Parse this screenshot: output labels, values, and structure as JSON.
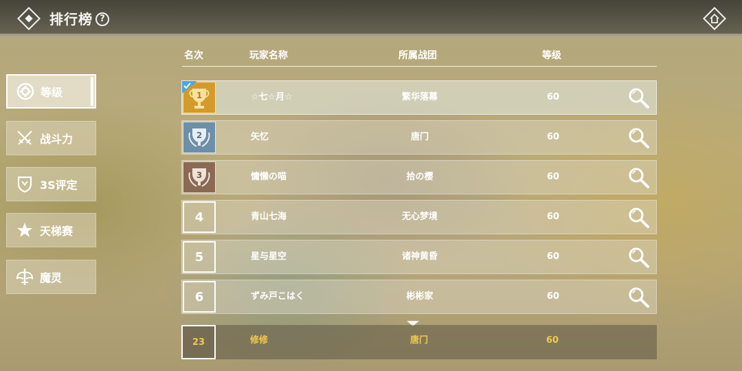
{
  "header": {
    "title": "排行榜",
    "help_icon": "?"
  },
  "sidebar": {
    "items": [
      {
        "label": "等级",
        "icon": "gear-icon",
        "active": true
      },
      {
        "label": "战斗力",
        "icon": "crossed-swords-icon",
        "active": false
      },
      {
        "label": "3S评定",
        "icon": "shield-crest-icon",
        "active": false
      },
      {
        "label": "天梯赛",
        "icon": "star-icon",
        "active": false
      },
      {
        "label": "魔灵",
        "icon": "winged-sword-icon",
        "active": false
      }
    ]
  },
  "table": {
    "columns": [
      "名次",
      "玩家名称",
      "所属战团",
      "等级"
    ],
    "rows": [
      {
        "rank": "1",
        "rank_style": "gold-trophy",
        "name": "☆七☆月☆",
        "guild": "繁华落幕",
        "level": "60",
        "selected": true
      },
      {
        "rank": "2",
        "rank_style": "silver-trophy",
        "name": "矢忆",
        "guild": "唐门",
        "level": "60",
        "selected": false
      },
      {
        "rank": "3",
        "rank_style": "bronze-trophy",
        "name": "慵懒の喵",
        "guild": "拾の樱",
        "level": "60",
        "selected": false
      },
      {
        "rank": "4",
        "rank_style": "number",
        "name": "青山七海",
        "guild": "无心梦境",
        "level": "60",
        "selected": false
      },
      {
        "rank": "5",
        "rank_style": "number",
        "name": "星与星空",
        "guild": "诸神黄昏",
        "level": "60",
        "selected": false
      },
      {
        "rank": "6",
        "rank_style": "number",
        "name": "ずみ戸こはく",
        "guild": "彬彬家",
        "level": "60",
        "selected": false
      }
    ],
    "self": {
      "rank": "23",
      "name": "修修",
      "guild": "唐门",
      "level": "60"
    }
  },
  "colors": {
    "self_highlight": "#f2c94c",
    "gold": "#d79a2a",
    "silver": "#6d8fa8",
    "bronze": "#8a6a55"
  }
}
